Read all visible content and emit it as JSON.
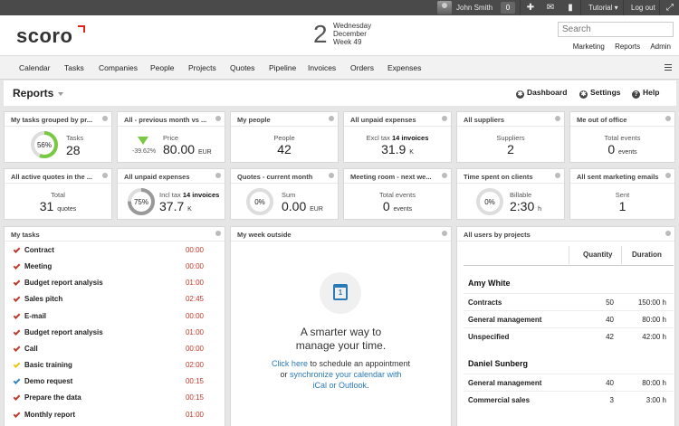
{
  "topbar": {
    "user_name": "John Smith",
    "notif_count": "0",
    "tutorial_label": "Tutorial",
    "logout_label": "Log out"
  },
  "header": {
    "logo": "scoro",
    "date_day": "2",
    "date_weekday": "Wednesday",
    "date_month": "December",
    "date_week": "Week 49",
    "search_placeholder": "Search",
    "links": [
      "Marketing",
      "Reports",
      "Admin"
    ]
  },
  "nav": [
    "Calendar",
    "Tasks",
    "Companies",
    "People",
    "Projects",
    "Quotes",
    "Pipeline",
    "Invoices",
    "Orders",
    "Expenses"
  ],
  "reportsbar": {
    "title": "Reports",
    "dashboard_label": "Dashboard",
    "settings_label": "Settings",
    "help_label": "Help"
  },
  "widgets_row1": [
    {
      "title": "My tasks grouped by pr...",
      "label": "Tasks",
      "value": "28",
      "ring": "56%",
      "ring_fraction": 0.56
    },
    {
      "title": "All - previous month vs ...",
      "label": "Price",
      "value": "80.00",
      "unit": "EUR",
      "delta": "-39.62%"
    },
    {
      "title": "My people",
      "label": "People",
      "value": "42"
    },
    {
      "title": "All unpaid expenses",
      "label_prefix": "Excl tax",
      "label_bold": "14 invoices",
      "value": "31.9",
      "unit": "K"
    },
    {
      "title": "All suppliers",
      "label": "Suppliers",
      "value": "2"
    },
    {
      "title": "Me out of office",
      "label": "Total events",
      "value": "0",
      "unit": "events"
    }
  ],
  "widgets_row2": [
    {
      "title": "All active quotes in the ...",
      "label": "Total",
      "value": "31",
      "unit": "quotes"
    },
    {
      "title": "All unpaid expenses",
      "label_prefix": "Incl tax",
      "label_bold": "14 invoices",
      "value": "37.7",
      "unit": "K",
      "ring": "75%",
      "ring_fraction": 0.75
    },
    {
      "title": "Quotes - current month",
      "label": "Sum",
      "value": "0.00",
      "unit": "EUR",
      "ring": "0%",
      "ring_fraction": 0
    },
    {
      "title": "Meeting room - next we...",
      "label": "Total events",
      "value": "0",
      "unit": "events"
    },
    {
      "title": "Time spent on clients",
      "label": "Billable",
      "value": "2:30",
      "unit": "h",
      "ring": "0%",
      "ring_fraction": 0
    },
    {
      "title": "All sent marketing emails",
      "label": "Sent",
      "value": "1"
    }
  ],
  "my_tasks": {
    "title": "My tasks",
    "items": [
      {
        "name": "Contract",
        "time": "00:00",
        "check_color": "#c0392b"
      },
      {
        "name": "Meeting",
        "time": "00:00",
        "check_color": "#c0392b"
      },
      {
        "name": "Budget report analysis",
        "time": "01:00",
        "check_color": "#c0392b"
      },
      {
        "name": "Sales pitch",
        "time": "02:45",
        "check_color": "#c0392b"
      },
      {
        "name": "E-mail",
        "time": "00:00",
        "check_color": "#c0392b"
      },
      {
        "name": "Budget report analysis",
        "time": "01:00",
        "check_color": "#c0392b"
      },
      {
        "name": "Call",
        "time": "00:00",
        "check_color": "#c0392b"
      },
      {
        "name": "Basic training",
        "time": "02:00",
        "check_color": "#f1c40f"
      },
      {
        "name": "Demo request",
        "time": "00:15",
        "check_color": "#2e86c1"
      },
      {
        "name": "Prepare the data",
        "time": "00:15",
        "check_color": "#c0392b"
      },
      {
        "name": "Monthly report",
        "time": "01:00",
        "check_color": "#c0392b"
      }
    ]
  },
  "week_outside": {
    "title": "My week outside",
    "calendar_day": "1",
    "headline_1": "A smarter way to",
    "headline_2": "manage your time.",
    "click_here": "Click here",
    "line1_rest": " to schedule an appointment",
    "line2_pre": "or ",
    "sync_link": "synchronize your calendar with",
    "line3_link": "iCal or Outlook",
    "line3_end": "."
  },
  "users_projects": {
    "title": "All users by projects",
    "col_quantity": "Quantity",
    "col_duration": "Duration",
    "users": [
      {
        "name": "Amy White",
        "rows": [
          {
            "project": "Contracts",
            "quantity": "50",
            "duration": "150:00 h"
          },
          {
            "project": "General management",
            "quantity": "40",
            "duration": "80:00 h"
          },
          {
            "project": "Unspecified",
            "quantity": "42",
            "duration": "42:00 h"
          }
        ]
      },
      {
        "name": "Daniel Sunberg",
        "rows": [
          {
            "project": "General management",
            "quantity": "40",
            "duration": "80:00 h"
          },
          {
            "project": "Commercial sales",
            "quantity": "3",
            "duration": "3:00 h"
          }
        ]
      }
    ]
  },
  "colors": {
    "accent_red": "#e0261f",
    "ring_green": "#7ac943",
    "link_blue": "#2a7ab8"
  }
}
